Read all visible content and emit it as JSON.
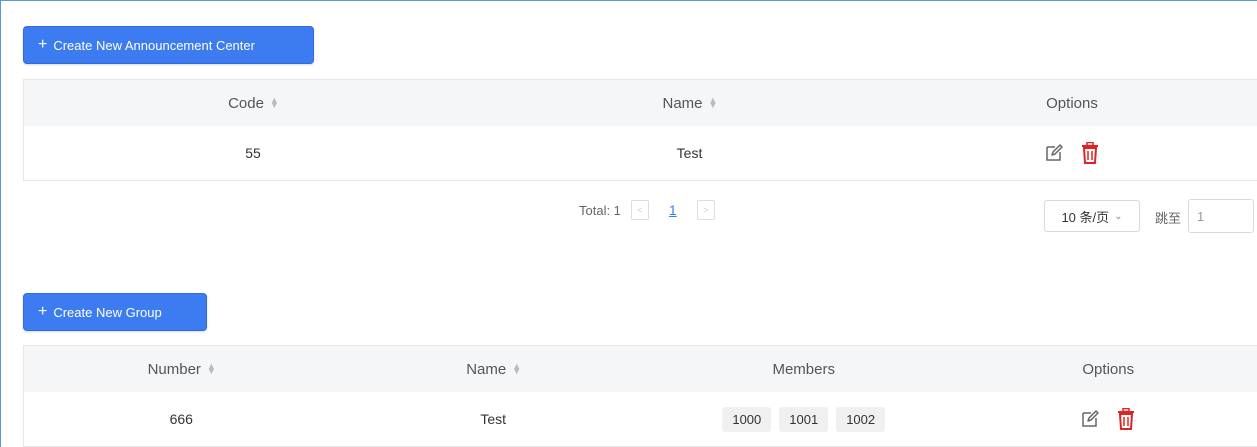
{
  "announcement_section": {
    "create_button_label": "Create New Announcement Center",
    "columns": {
      "code": "Code",
      "name": "Name",
      "options": "Options"
    },
    "rows": [
      {
        "code": "55",
        "name": "Test"
      }
    ],
    "pagination": {
      "total_label": "Total: 1",
      "current_page": "1",
      "prev_glyph": "<",
      "next_glyph": ">",
      "page_size_label": "10 条/页",
      "jump_label": "跳至",
      "jump_value": "1"
    }
  },
  "group_section": {
    "create_button_label": "Create New Group",
    "columns": {
      "number": "Number",
      "name": "Name",
      "members": "Members",
      "options": "Options"
    },
    "rows": [
      {
        "number": "666",
        "name": "Test",
        "members": [
          "1000",
          "1001",
          "1002"
        ]
      }
    ]
  },
  "icons": {
    "add": "plus-icon",
    "edit": "edit-icon",
    "delete": "trash-icon",
    "sort": "sort-icon"
  },
  "colors": {
    "primary": "#3c7cf0",
    "delete": "#e02424",
    "header_bg": "#f5f6f8"
  }
}
